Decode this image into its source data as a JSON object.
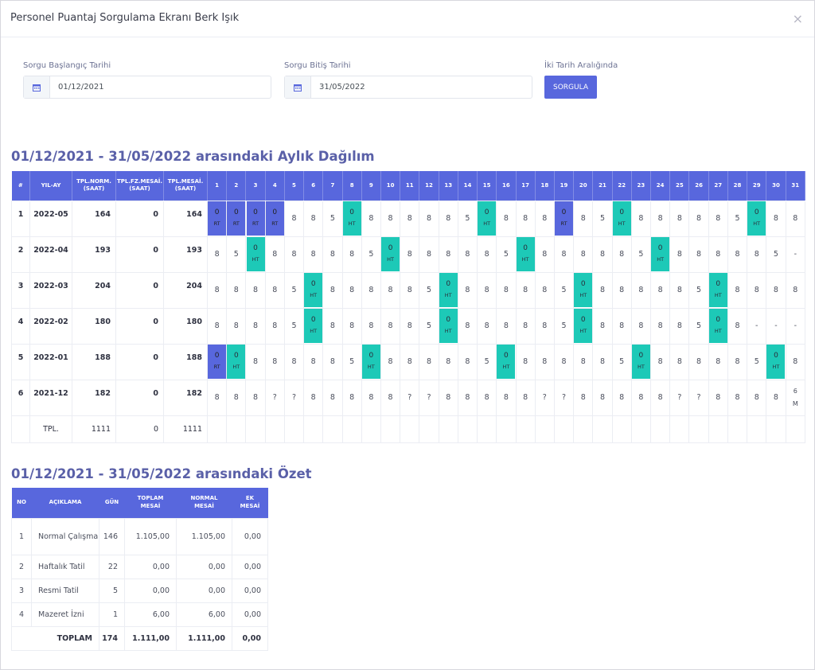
{
  "header": {
    "title": "Personel Puantaj Sorgulama Ekranı",
    "person": "Berk Işık",
    "close": "×"
  },
  "form": {
    "start_label": "Sorgu Başlangıç Tarihi",
    "start_value": "01/12/2021",
    "end_label": "Sorgu Bitiş Tarihi",
    "end_value": "31/05/2022",
    "range_label": "İki Tarih Aralığında",
    "button": "SORGULA"
  },
  "monthly": {
    "title": "01/12/2021 - 31/05/2022 arasındaki Aylık Dağılım",
    "headers": {
      "no": "#",
      "month": "YIL-AY",
      "norm": "TPL.NORM.\n(SAAT)",
      "ot": "TPL.FZ.MESAİ.\n(SAAT)",
      "total": "TPL.MESAİ.\n(SAAT)"
    },
    "days": [
      "1",
      "2",
      "3",
      "4",
      "5",
      "6",
      "7",
      "8",
      "9",
      "10",
      "11",
      "12",
      "13",
      "14",
      "15",
      "16",
      "17",
      "18",
      "19",
      "20",
      "21",
      "22",
      "23",
      "24",
      "25",
      "26",
      "27",
      "28",
      "29",
      "30",
      "31"
    ],
    "rows": [
      {
        "no": "1",
        "month": "2022-05",
        "norm": "164",
        "ot": "0",
        "total": "164",
        "cells": [
          [
            "0",
            "RT"
          ],
          [
            "0",
            "RT"
          ],
          [
            "0",
            "RT"
          ],
          [
            "0",
            "RT"
          ],
          "8",
          "8",
          "5",
          [
            "0",
            "HT"
          ],
          "8",
          "8",
          "8",
          "8",
          "8",
          "5",
          [
            "0",
            "HT"
          ],
          "8",
          "8",
          "8",
          [
            "0",
            "RT"
          ],
          "8",
          "5",
          [
            "0",
            "HT"
          ],
          "8",
          "8",
          "8",
          "8",
          "8",
          "5",
          [
            "0",
            "HT"
          ],
          "8",
          "8"
        ]
      },
      {
        "no": "2",
        "month": "2022-04",
        "norm": "193",
        "ot": "0",
        "total": "193",
        "cells": [
          "8",
          "5",
          [
            "0",
            "HT"
          ],
          "8",
          "8",
          "8",
          "8",
          "8",
          "5",
          [
            "0",
            "HT"
          ],
          "8",
          "8",
          "8",
          "8",
          "8",
          "5",
          [
            "0",
            "HT"
          ],
          "8",
          "8",
          "8",
          "8",
          "8",
          "5",
          [
            "0",
            "HT"
          ],
          "8",
          "8",
          "8",
          "8",
          "8",
          "5",
          "-"
        ]
      },
      {
        "no": "3",
        "month": "2022-03",
        "norm": "204",
        "ot": "0",
        "total": "204",
        "cells": [
          "8",
          "8",
          "8",
          "8",
          "5",
          [
            "0",
            "HT"
          ],
          "8",
          "8",
          "8",
          "8",
          "8",
          "5",
          [
            "0",
            "HT"
          ],
          "8",
          "8",
          "8",
          "8",
          "8",
          "5",
          [
            "0",
            "HT"
          ],
          "8",
          "8",
          "8",
          "8",
          "8",
          "5",
          [
            "0",
            "HT"
          ],
          "8",
          "8",
          "8",
          "8"
        ]
      },
      {
        "no": "4",
        "month": "2022-02",
        "norm": "180",
        "ot": "0",
        "total": "180",
        "cells": [
          "8",
          "8",
          "8",
          "8",
          "5",
          [
            "0",
            "HT"
          ],
          "8",
          "8",
          "8",
          "8",
          "8",
          "5",
          [
            "0",
            "HT"
          ],
          "8",
          "8",
          "8",
          "8",
          "8",
          "5",
          [
            "0",
            "HT"
          ],
          "8",
          "8",
          "8",
          "8",
          "8",
          "5",
          [
            "0",
            "HT"
          ],
          "8",
          "-",
          "-",
          "-"
        ]
      },
      {
        "no": "5",
        "month": "2022-01",
        "norm": "188",
        "ot": "0",
        "total": "188",
        "cells": [
          [
            "0",
            "RT"
          ],
          [
            "0",
            "HT"
          ],
          "8",
          "8",
          "8",
          "8",
          "8",
          "5",
          [
            "0",
            "HT"
          ],
          "8",
          "8",
          "8",
          "8",
          "8",
          "5",
          [
            "0",
            "HT"
          ],
          "8",
          "8",
          "8",
          "8",
          "8",
          "5",
          [
            "0",
            "HT"
          ],
          "8",
          "8",
          "8",
          "8",
          "8",
          "5",
          [
            "0",
            "HT"
          ],
          "8"
        ]
      },
      {
        "no": "6",
        "month": "2021-12",
        "norm": "182",
        "ot": "0",
        "total": "182",
        "cells": [
          "8",
          "8",
          "8",
          "?",
          "?",
          "8",
          "8",
          "8",
          "8",
          "8",
          "?",
          "?",
          "8",
          "8",
          "8",
          "8",
          "8",
          "?",
          "?",
          "8",
          "8",
          "8",
          "8",
          "8",
          "?",
          "?",
          "8",
          "8",
          "8",
          "8",
          "6\nM"
        ]
      }
    ],
    "totals": {
      "label": "TPL.",
      "norm": "1111",
      "ot": "0",
      "total": "1111"
    }
  },
  "summary": {
    "title": "01/12/2021 - 31/05/2022 arasındaki Özet",
    "headers": {
      "no": "NO",
      "desc": "AÇIKLAMA",
      "days": "GÜN",
      "total": "TOPLAM\nMESAİ",
      "normal": "NORMAL\nMESAİ",
      "extra": "EK\nMESAİ"
    },
    "rows": [
      {
        "no": "1",
        "desc": "Normal Çalışma",
        "days": "146",
        "total": "1.105,00",
        "normal": "1.105,00",
        "extra": "0,00"
      },
      {
        "no": "2",
        "desc": "Haftalık Tatil",
        "days": "22",
        "total": "0,00",
        "normal": "0,00",
        "extra": "0,00"
      },
      {
        "no": "3",
        "desc": "Resmi Tatil",
        "days": "5",
        "total": "0,00",
        "normal": "0,00",
        "extra": "0,00"
      },
      {
        "no": "4",
        "desc": "Mazeret İzni",
        "days": "1",
        "total": "6,00",
        "normal": "6,00",
        "extra": "0,00"
      }
    ],
    "total_row": {
      "label": "TOPLAM",
      "days": "174",
      "total": "1.111,00",
      "normal": "1.111,00",
      "extra": "0,00"
    }
  },
  "colors": {
    "accent": "#5867dd",
    "holiday_weekly": "#1dc9b7",
    "holiday_official": "#5867dd"
  },
  "icons": {
    "date": "calendar-icon",
    "close": "close-icon"
  }
}
